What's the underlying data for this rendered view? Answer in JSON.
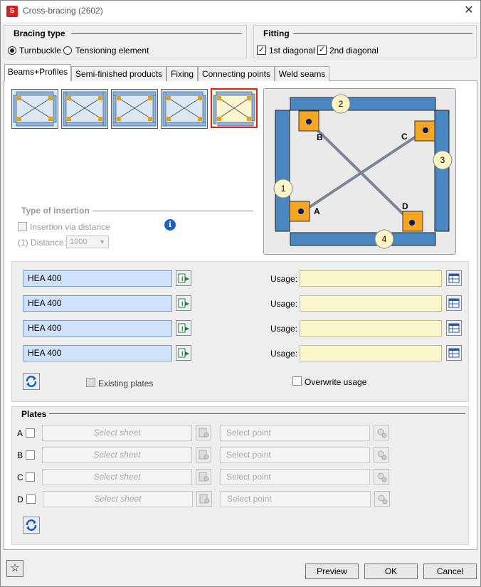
{
  "window": {
    "title": "Cross-bracing (2602)",
    "app_icon_text": "S"
  },
  "bracing_type": {
    "title": "Bracing type",
    "options": [
      {
        "label": "Turnbuckle",
        "selected": true
      },
      {
        "label": "Tensioning element",
        "selected": false
      }
    ]
  },
  "fitting": {
    "title": "Fitting",
    "options": [
      {
        "label": "1st diagonal",
        "checked": true
      },
      {
        "label": "2nd diagonal",
        "checked": true
      }
    ]
  },
  "tabs": [
    {
      "label": "Beams+Profiles",
      "active": true
    },
    {
      "label": "Semi-finished products",
      "active": false
    },
    {
      "label": "Fixing",
      "active": false
    },
    {
      "label": "Connecting points",
      "active": false
    },
    {
      "label": "Weld seams",
      "active": false
    }
  ],
  "type_of_insertion": {
    "title": "Type of insertion",
    "checkbox_label": "Insertion via distance",
    "distance_label": "(1) Distance:",
    "distance_value": "1000"
  },
  "preview": {
    "beam_numbers": [
      "1",
      "2",
      "3",
      "4"
    ],
    "points": [
      "A",
      "B",
      "C",
      "D"
    ],
    "colors": {
      "beam": "#4a86bf",
      "plate": "#f5a623",
      "diagonal": "#7a8694",
      "dot": "#0a1a6a"
    }
  },
  "profiles": [
    {
      "value": "HEA 400",
      "usage_label": "Usage:",
      "usage_value": ""
    },
    {
      "value": "HEA 400",
      "usage_label": "Usage:",
      "usage_value": ""
    },
    {
      "value": "HEA 400",
      "usage_label": "Usage:",
      "usage_value": ""
    },
    {
      "value": "HEA 400",
      "usage_label": "Usage:",
      "usage_value": ""
    }
  ],
  "existing_plates_label": "Existing plates",
  "overwrite_usage_label": "Overwrite usage",
  "plates": {
    "title": "Plates",
    "rows": [
      {
        "letter": "A",
        "sheet_placeholder": "Select sheet",
        "point_placeholder": "Select point"
      },
      {
        "letter": "B",
        "sheet_placeholder": "Select sheet",
        "point_placeholder": "Select point"
      },
      {
        "letter": "C",
        "sheet_placeholder": "Select sheet",
        "point_placeholder": "Select point"
      },
      {
        "letter": "D",
        "sheet_placeholder": "Select sheet",
        "point_placeholder": "Select point"
      }
    ]
  },
  "buttons": {
    "preview": "Preview",
    "ok": "OK",
    "cancel": "Cancel"
  }
}
